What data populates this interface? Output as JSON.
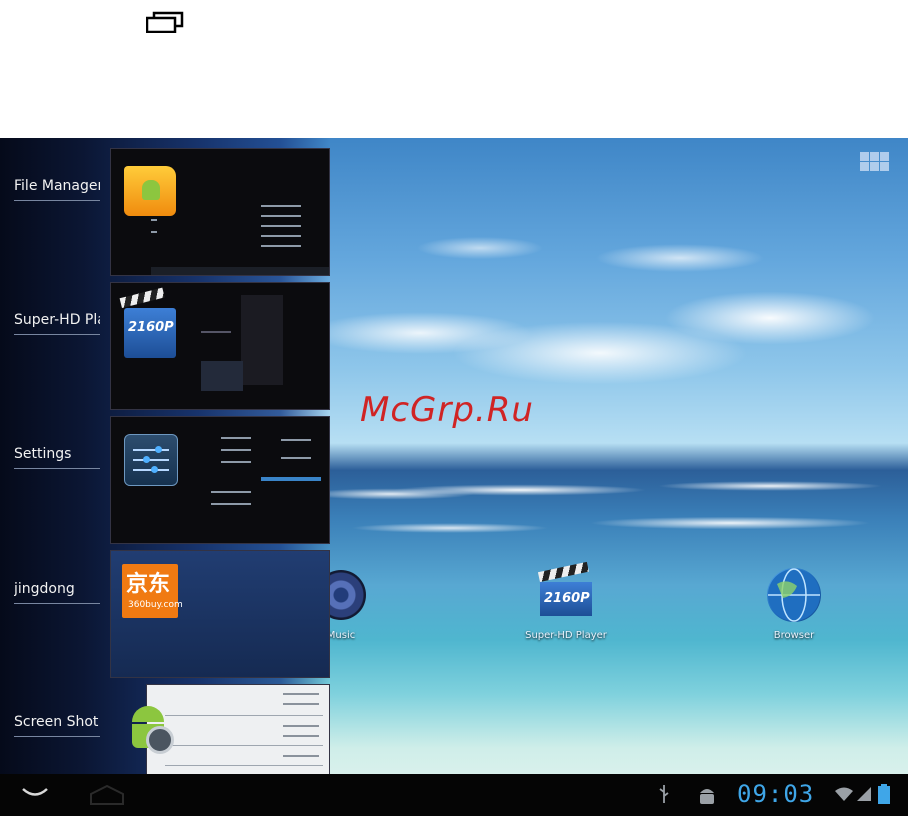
{
  "top": {
    "icon": "recent-apps-icon"
  },
  "watermark": {
    "text": "McGrp.Ru",
    "color": "#d02424"
  },
  "recent_apps": [
    {
      "label": "File Manager",
      "icon": "file-manager-folder-icon"
    },
    {
      "label": "Super-HD Player",
      "icon": "super-hd-player-icon",
      "icon_text": "2160P"
    },
    {
      "label": "Settings",
      "icon": "settings-sliders-icon"
    },
    {
      "label": "jingdong",
      "icon": "jingdong-icon",
      "icon_text": "京东",
      "icon_subtext": "360buy.com"
    },
    {
      "label": "Screen Shot",
      "icon": "screen-shot-android-icon"
    }
  ],
  "desktop": {
    "apps_button_icon": "apps-grid-icon",
    "shortcuts": [
      {
        "label": "Music",
        "icon": "music-speaker-icon"
      },
      {
        "label": "Super-HD Player",
        "icon": "super-hd-player-icon",
        "icon_text": "2160P"
      },
      {
        "label": "Browser",
        "icon": "browser-globe-icon"
      }
    ]
  },
  "status_bar": {
    "time": "09:03",
    "time_color": "#3fa6e8",
    "icons": [
      "back-icon",
      "home-icon",
      "usb-icon",
      "android-debug-icon",
      "wifi-icon",
      "signal-icon",
      "battery-icon"
    ]
  }
}
